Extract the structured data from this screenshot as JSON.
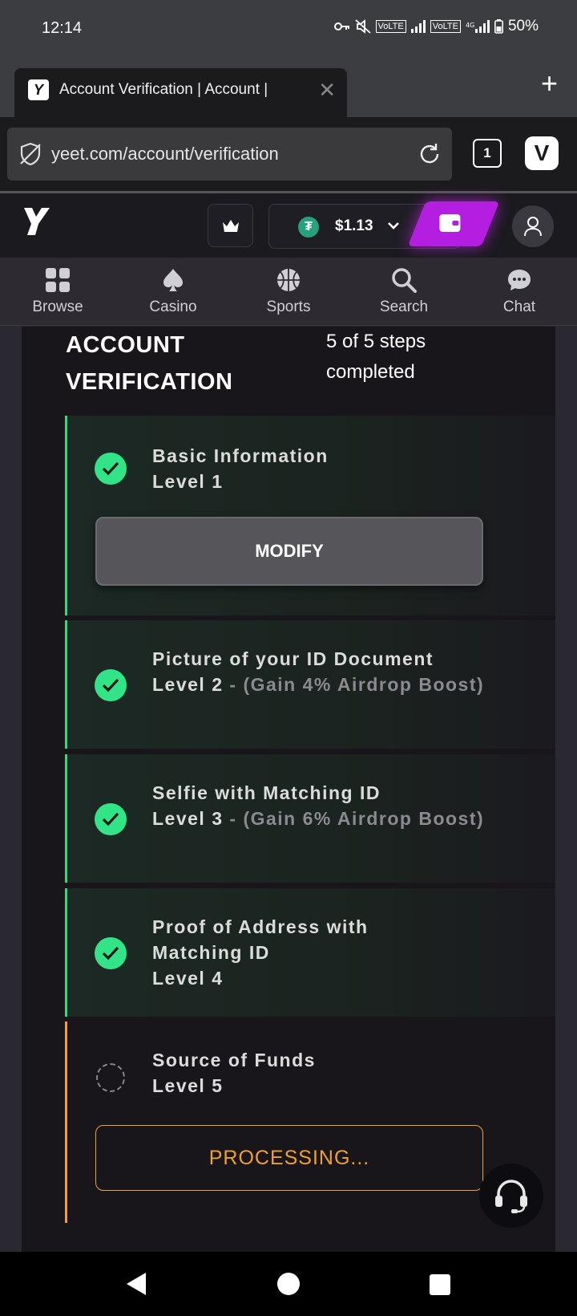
{
  "status_bar": {
    "time": "12:14",
    "volte1": "VoLTE",
    "volte2": "VoLTE",
    "battery": "50%"
  },
  "browser": {
    "tab_title": "Account Verification | Account |",
    "tab_close": "✕",
    "new_tab": "+",
    "url": "yeet.com/account/verification",
    "tab_count": "1"
  },
  "site_header": {
    "currency_symbol": "₮",
    "balance": "$1.13"
  },
  "nav": [
    {
      "label": "Browse",
      "icon": "grid-icon"
    },
    {
      "label": "Casino",
      "icon": "spade-icon"
    },
    {
      "label": "Sports",
      "icon": "basketball-icon"
    },
    {
      "label": "Search",
      "icon": "search-icon"
    },
    {
      "label": "Chat",
      "icon": "chat-icon"
    }
  ],
  "verification": {
    "title": "ACCOUNT VERIFICATION",
    "progress": "5 of 5 steps completed",
    "steps": [
      {
        "title": "Basic Information",
        "level": "Level 1",
        "bonus": "",
        "status": "completed"
      },
      {
        "title": "Picture of your ID Document",
        "level": "Level 2",
        "bonus": " - (Gain 4% Airdrop Boost)",
        "status": "completed"
      },
      {
        "title": "Selfie with Matching ID",
        "level": "Level 3",
        "bonus": " - (Gain 6% Airdrop Boost)",
        "status": "completed"
      },
      {
        "title": "Proof of Address with Matching ID",
        "level": "Level 4",
        "bonus": "",
        "status": "completed"
      },
      {
        "title": "Source of Funds",
        "level": "Level 5",
        "bonus": "",
        "status": "processing"
      }
    ],
    "modify_label": "MODIFY",
    "processing_label": "PROCESSING..."
  },
  "colors": {
    "accent_green": "#32e387",
    "accent_orange": "#f0a030",
    "wallet_purple": "#b41ee0"
  }
}
